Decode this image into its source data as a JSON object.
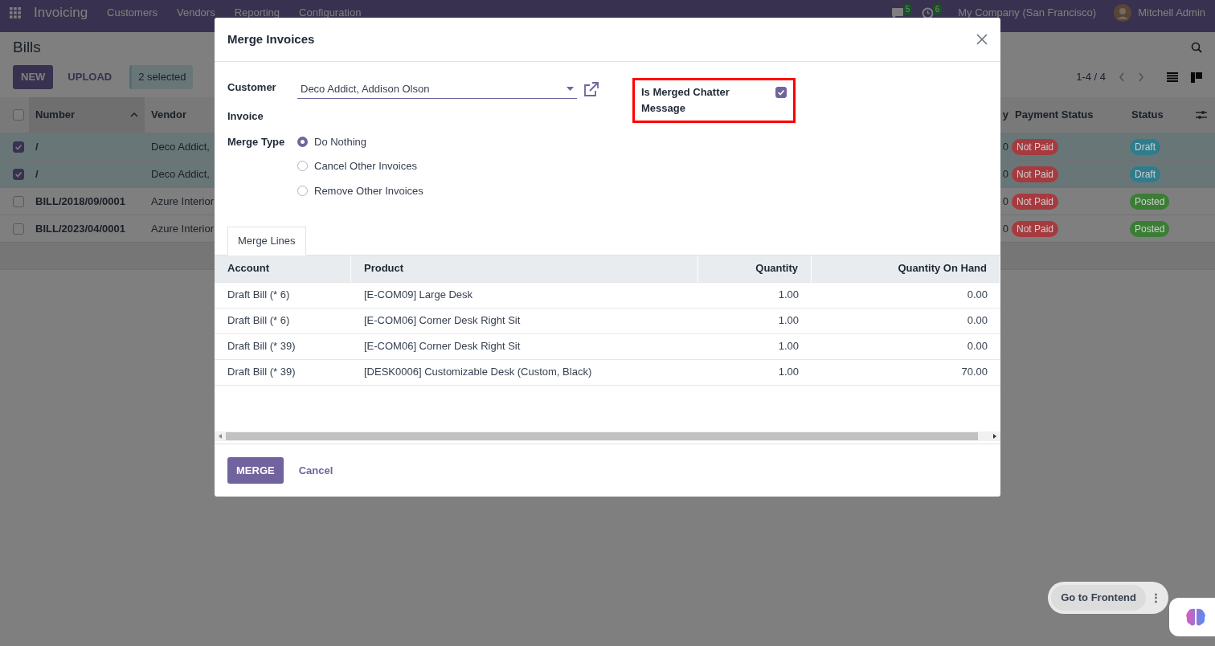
{
  "navbar": {
    "app_name": "Invoicing",
    "menu": [
      "Customers",
      "Vendors",
      "Reporting",
      "Configuration"
    ],
    "messages_count": "5",
    "activities_count": "6",
    "company": "My Company (San Francisco)",
    "user": "Mitchell Admin"
  },
  "page": {
    "title": "Bills",
    "buttons": [
      {
        "label": "NEW",
        "kind": "primary"
      },
      {
        "label": "UPLOAD",
        "kind": "link"
      }
    ],
    "selection": "2 selected",
    "pager": "1-4 / 4"
  },
  "list": {
    "all_selected": false,
    "columns": [
      {
        "label": "Number",
        "sorted": true
      },
      {
        "label": "Vendor",
        "sorted": false
      },
      {
        "label": "y",
        "sorted": false
      },
      {
        "label": "Payment Status",
        "sorted": false
      },
      {
        "label": "Status",
        "sorted": false
      }
    ],
    "rows": [
      {
        "selected": true,
        "number": "/",
        "vendor": "Deco Addict,",
        "column_3": "0",
        "payment_status": "Not Paid",
        "status": {
          "label": "Draft",
          "color": "#2f7d8c"
        }
      },
      {
        "selected": true,
        "number": "/",
        "vendor": "Deco Addict,",
        "column_3": "0",
        "payment_status": "Not Paid",
        "status": {
          "label": "Draft",
          "color": "#2f7d8c"
        }
      },
      {
        "selected": false,
        "number": "BILL/2018/09/0001",
        "vendor": "Azure Interior",
        "column_3": "0",
        "payment_status": "Not Paid",
        "status": {
          "label": "Posted",
          "color": "#3b7d35"
        }
      },
      {
        "selected": false,
        "number": "BILL/2023/04/0001",
        "vendor": "Azure Interior",
        "column_3": "0",
        "payment_status": "Not Paid",
        "status": {
          "label": "Posted",
          "color": "#3b7d35"
        }
      }
    ]
  },
  "dialog": {
    "title": "Merge Invoices",
    "customer_label": "Customer",
    "customer_value": "Deco Addict, Addison Olson",
    "invoice_label": "Invoice",
    "chatter_label": "Is Merged Chatter Message",
    "chatter_checked": true,
    "chatter_highlighted": true,
    "merge_type_label": "Merge Type",
    "merge_options": [
      {
        "label": "Do Nothing",
        "selected": true
      },
      {
        "label": "Cancel Other Invoices",
        "selected": false
      },
      {
        "label": "Remove Other Invoices",
        "selected": false
      }
    ],
    "tabs": [
      {
        "label": "Merge Lines",
        "selected": true
      }
    ],
    "lines": {
      "columns": [
        "Account",
        "Product",
        "Quantity",
        "Quantity On Hand"
      ],
      "rows": [
        [
          "Draft Bill (* 6)",
          "[E-COM09] Large Desk",
          "1.00",
          "0.00"
        ],
        [
          "Draft Bill (* 6)",
          "[E-COM06] Corner Desk Right Sit",
          "1.00",
          "0.00"
        ],
        [
          "Draft Bill (* 39)",
          "[E-COM06] Corner Desk Right Sit",
          "1.00",
          "0.00"
        ],
        [
          "Draft Bill (* 39)",
          "[DESK0006] Customizable Desk (Custom, Black)",
          "1.00",
          "70.00"
        ]
      ]
    },
    "buttons": [
      {
        "label": "MERGE",
        "kind": "primary"
      },
      {
        "label": "Cancel",
        "kind": "link"
      }
    ]
  },
  "floating": {
    "frontend_button": "Go to Frontend",
    "more": "⋮"
  }
}
